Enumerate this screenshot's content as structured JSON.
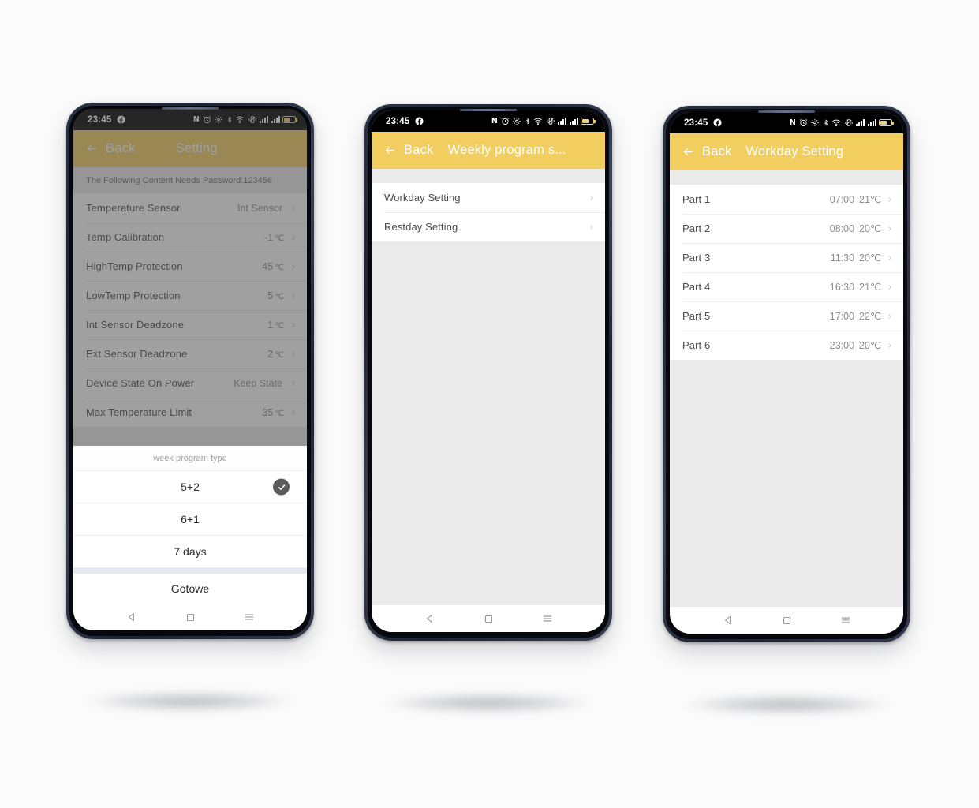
{
  "colors": {
    "accent": "#f2cd60",
    "accent_dimmed": "#8a7330",
    "page_background": "#fbfbfb",
    "list_background": "#ffffff",
    "content_background": "#eaeaea",
    "status_bar": "#000000",
    "check_circle": "#5b5b5b"
  },
  "status_bar": {
    "time": "23:45",
    "icons": [
      "facebook-icon",
      "nfc-icon",
      "alarm-icon",
      "location-off-icon",
      "bluetooth-icon",
      "wifi-icon",
      "vibrate-icon",
      "signal-bars-icon",
      "signal-bars-icon",
      "battery-icon"
    ]
  },
  "nav_bar": {
    "back_label": "back-triangle-icon",
    "home_label": "home-square-icon",
    "recents_label": "recents-menu-icon"
  },
  "phone1": {
    "header": {
      "back": "Back",
      "title": "Setting"
    },
    "hint": "The Following Content Needs Password:123456",
    "settings": [
      {
        "label": "Temperature Sensor",
        "value": "Int Sensor",
        "unit": ""
      },
      {
        "label": "Temp Calibration",
        "value": "-1",
        "unit": "℃"
      },
      {
        "label": "HighTemp Protection",
        "value": "45",
        "unit": "℃"
      },
      {
        "label": "LowTemp Protection",
        "value": "5",
        "unit": "℃"
      },
      {
        "label": "Int Sensor Deadzone",
        "value": "1",
        "unit": "℃"
      },
      {
        "label": "Ext Sensor Deadzone",
        "value": "2",
        "unit": "℃"
      },
      {
        "label": "Device State On Power",
        "value": "Keep State",
        "unit": ""
      },
      {
        "label": "Max Temperature Limit",
        "value": "35",
        "unit": "℃"
      }
    ],
    "sheet": {
      "title": "week program type",
      "options": [
        {
          "label": "5+2",
          "selected": true
        },
        {
          "label": "6+1",
          "selected": false
        },
        {
          "label": "7 days",
          "selected": false
        }
      ],
      "done_label": "Gotowe"
    }
  },
  "phone2": {
    "header": {
      "back": "Back",
      "title": "Weekly program s..."
    },
    "items": [
      {
        "label": "Workday Setting"
      },
      {
        "label": "Restday Setting"
      }
    ]
  },
  "phone3": {
    "header": {
      "back": "Back",
      "title": "Workday Setting"
    },
    "parts": [
      {
        "label": "Part 1",
        "time": "07:00",
        "temp": "21℃"
      },
      {
        "label": "Part 2",
        "time": "08:00",
        "temp": "20℃"
      },
      {
        "label": "Part 3",
        "time": "11:30",
        "temp": "20℃"
      },
      {
        "label": "Part 4",
        "time": "16:30",
        "temp": "21℃"
      },
      {
        "label": "Part 5",
        "time": "17:00",
        "temp": "22℃"
      },
      {
        "label": "Part 6",
        "time": "23:00",
        "temp": "20℃"
      }
    ]
  }
}
